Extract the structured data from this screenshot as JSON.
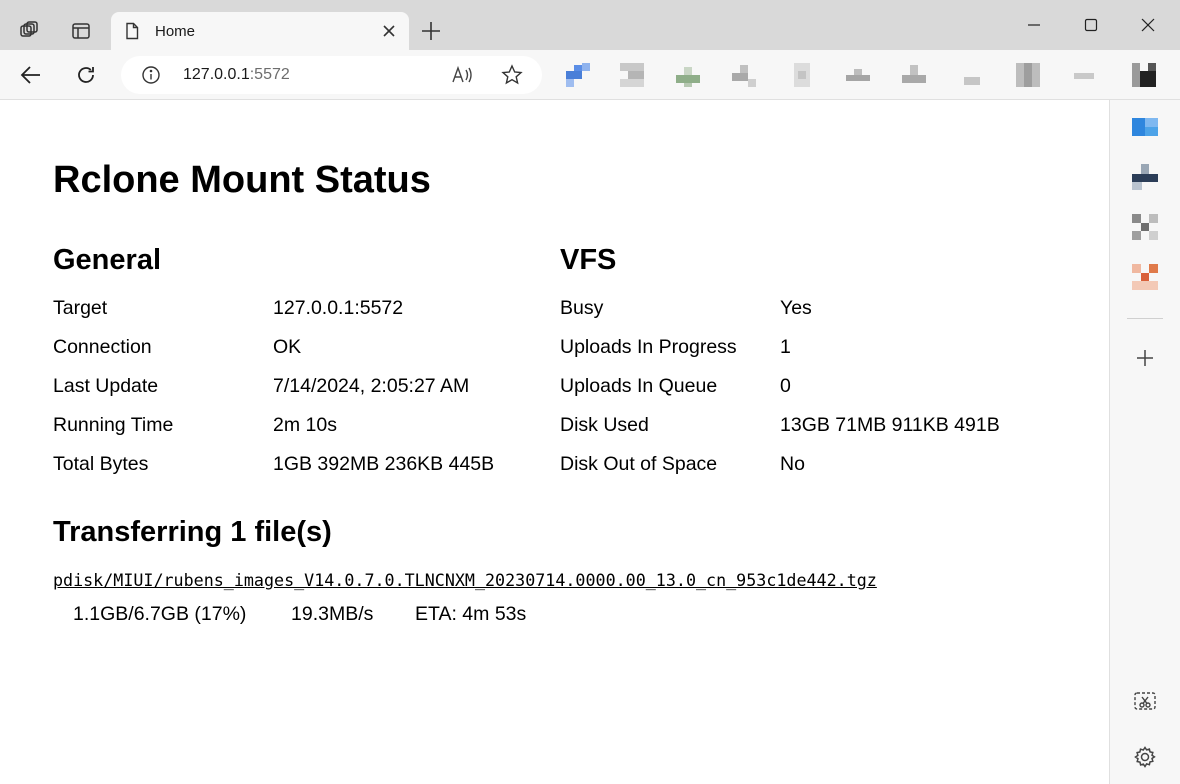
{
  "browser": {
    "tab_title": "Home",
    "url_host": "127.0.0.1",
    "url_port": ":5572",
    "icons": {
      "workspaces": "workspaces-icon",
      "vertical_tabs": "vertical-tabs-icon",
      "page": "page-icon",
      "close_tab": "close-icon",
      "new_tab": "plus-icon",
      "back": "back-arrow-icon",
      "refresh": "refresh-icon",
      "info": "info-icon",
      "read_aloud": "read-aloud-icon",
      "favorite": "star-icon",
      "minimize": "minimize-icon",
      "maximize": "maximize-icon",
      "close_window": "close-window-icon",
      "sidebar_add": "plus-icon",
      "screenshot": "screenshot-icon",
      "settings": "gear-icon"
    }
  },
  "page": {
    "title": "Rclone Mount Status",
    "general": {
      "heading": "General",
      "rows": [
        {
          "label": "Target",
          "value": "127.0.0.1:5572"
        },
        {
          "label": "Connection",
          "value": "OK"
        },
        {
          "label": "Last Update",
          "value": "7/14/2024, 2:05:27 AM"
        },
        {
          "label": "Running Time",
          "value": "2m 10s"
        },
        {
          "label": "Total Bytes",
          "value": "1GB 392MB 236KB 445B"
        }
      ]
    },
    "vfs": {
      "heading": "VFS",
      "rows": [
        {
          "label": "Busy",
          "value": "Yes"
        },
        {
          "label": "Uploads In Progress",
          "value": "1"
        },
        {
          "label": "Uploads In Queue",
          "value": "0"
        },
        {
          "label": "Disk Used",
          "value": "13GB 71MB 911KB 491B"
        },
        {
          "label": "Disk Out of Space",
          "value": "No"
        }
      ]
    },
    "transferring": {
      "heading": "Transferring 1 file(s)",
      "file": "pdisk/MIUI/rubens_images_V14.0.7.0.TLNCNXM_20230714.0000.00_13.0_cn_953c1de442.tgz",
      "progress": "1.1GB/6.7GB (17%)",
      "speed": "19.3MB/s",
      "eta": "ETA: 4m 53s"
    }
  }
}
